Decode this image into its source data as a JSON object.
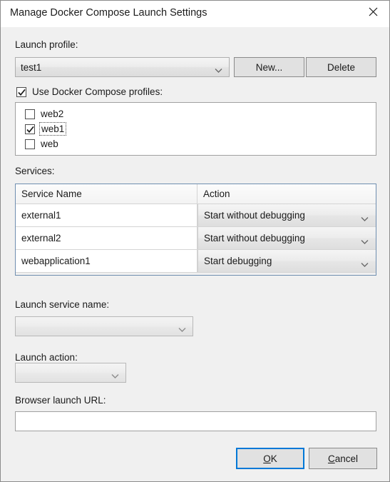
{
  "window": {
    "title": "Manage Docker Compose Launch Settings",
    "close_icon": "close-icon"
  },
  "launch_profile": {
    "label": "Launch profile:",
    "value": "test1",
    "new_button": "New...",
    "new_button_accel": "",
    "delete_button": "Delete"
  },
  "compose_profiles": {
    "checkbox_label": "Use Docker Compose profiles:",
    "checked": true,
    "items": [
      {
        "label": "web2",
        "checked": false,
        "focused": false
      },
      {
        "label": "web1",
        "checked": true,
        "focused": true
      },
      {
        "label": "web",
        "checked": false,
        "focused": false
      }
    ]
  },
  "services": {
    "label": "Services:",
    "columns": [
      "Service Name",
      "Action"
    ],
    "rows": [
      {
        "name": "external1",
        "action": "Start without debugging"
      },
      {
        "name": "external2",
        "action": "Start without debugging"
      },
      {
        "name": "webapplication1",
        "action": "Start debugging"
      }
    ]
  },
  "launch_service_name": {
    "label": "Launch service name:",
    "value": ""
  },
  "launch_action": {
    "label": "Launch action:",
    "value": ""
  },
  "browser_launch_url": {
    "label": "Browser launch URL:",
    "value": "",
    "placeholder": ""
  },
  "footer": {
    "ok_accel": "O",
    "ok_rest": "K",
    "cancel_accel": "C",
    "cancel_rest": "ancel"
  },
  "colors": {
    "accent": "#0078d7",
    "dialog_bg": "#f0f0f0",
    "titlebar_bg": "#ffffff",
    "grid_border": "#6f8eb0",
    "text": "#1a1a1a"
  }
}
